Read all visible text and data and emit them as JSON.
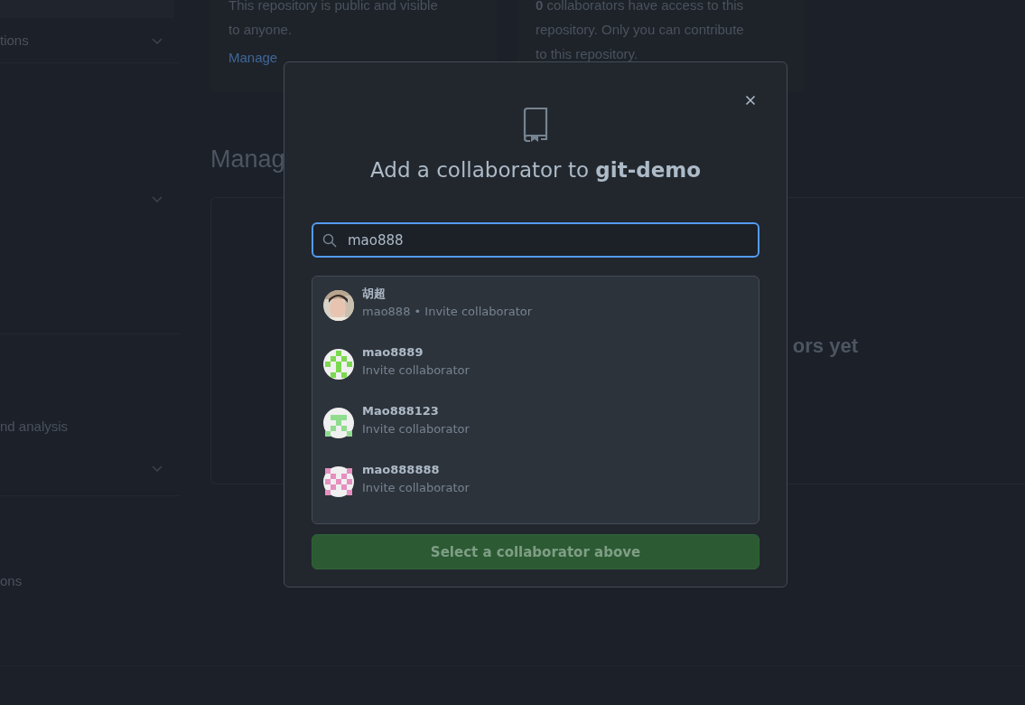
{
  "sidebar": {
    "items": [
      {
        "label": "tions",
        "collapsible": true
      },
      {
        "collapsible": true
      },
      {
        "label": "nd analysis"
      },
      {
        "collapsible": true
      },
      {
        "label": "ons"
      }
    ]
  },
  "cards": [
    {
      "lines": [
        "This repository is public and visible",
        "to anyone."
      ],
      "link": "Manage"
    },
    {
      "lines": [
        "**0** collaborators have access to this",
        "repository. Only you can contribute",
        "to this repository."
      ]
    }
  ],
  "section": {
    "heading": "Manag",
    "empty_message": "ors yet"
  },
  "dialog": {
    "title": "Add a collaborator to **git-demo**",
    "search": {
      "value": "mao888"
    },
    "results": [
      {
        "name": "胡超",
        "detail": "mao888 • Invite collaborator"
      },
      {
        "kind": "identicon",
        "name": "mao8889",
        "detail": "Invite collaborator",
        "color": "#7bd94e"
      },
      {
        "kind": "identicon",
        "name": "Mao888123",
        "detail": "Invite collaborator",
        "color": "#90dc8f"
      },
      {
        "kind": "identicon",
        "name": "mao888888",
        "detail": "Invite collaborator",
        "color": "#e68fc0"
      }
    ],
    "button": {
      "label": "Select a collaborator above",
      "disabled": true
    }
  }
}
